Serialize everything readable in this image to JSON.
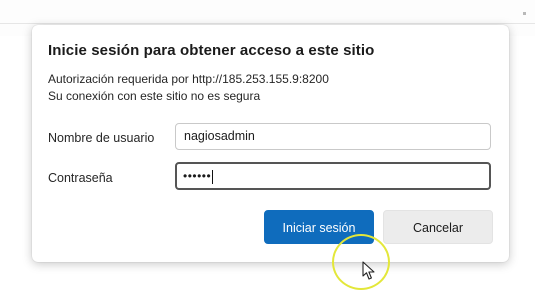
{
  "dialog": {
    "title": "Inicie sesión para obtener acceso a este sitio",
    "auth_line": "Autorización requerida por http://185.253.155.9:8200",
    "security_line": "Su conexión con este sitio no es segura",
    "username_label": "Nombre de usuario",
    "username_value": "nagiosadmin",
    "password_label": "Contraseña",
    "password_mask": "••••••",
    "signin_label": "Iniciar sesión",
    "cancel_label": "Cancelar"
  },
  "colors": {
    "primary": "#0f6cbd",
    "secondary": "#ececec",
    "cursor_highlight": "#e3e73a"
  },
  "icons": {
    "pointer": "mouse-pointer-icon",
    "highlight": "cursor-highlight-ring"
  }
}
